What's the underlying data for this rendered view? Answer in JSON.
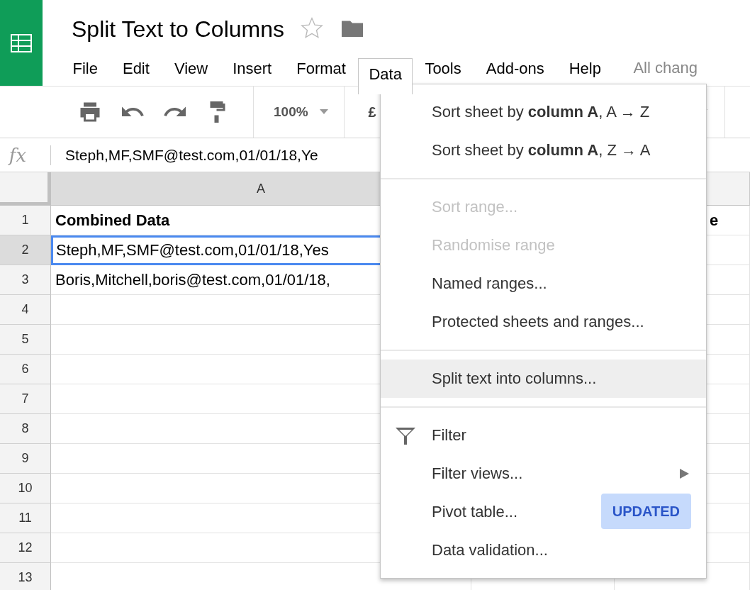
{
  "document": {
    "title": "Split Text to Columns",
    "starred": false
  },
  "menubar": {
    "items": [
      {
        "label": "File",
        "selected": false
      },
      {
        "label": "Edit",
        "selected": false
      },
      {
        "label": "View",
        "selected": false
      },
      {
        "label": "Insert",
        "selected": false
      },
      {
        "label": "Format",
        "selected": false
      },
      {
        "label": "Data",
        "selected": true
      },
      {
        "label": "Tools",
        "selected": false
      },
      {
        "label": "Add-ons",
        "selected": false
      },
      {
        "label": "Help",
        "selected": false
      }
    ],
    "save_status": "All chang"
  },
  "toolbar": {
    "zoom": "100%",
    "currency": "£"
  },
  "formula_bar": {
    "label": "fx",
    "value": "Steph,MF,SMF@test.com,01/01/18,Ye"
  },
  "sheet": {
    "columns": [
      {
        "label": "A",
        "selected": true
      },
      {},
      {
        "selected": false
      }
    ],
    "rows": [
      {
        "number": "1",
        "selected": false,
        "kind": "header",
        "cells": [
          "Combined Data",
          null,
          "e"
        ]
      },
      {
        "number": "2",
        "selected": true,
        "kind": "data",
        "cells": [
          "Steph,MF,SMF@test.com,01/01/18,Yes"
        ]
      },
      {
        "number": "3",
        "selected": false,
        "kind": "data",
        "cells": [
          "Boris,Mitchell,boris@test.com,01/01/18,"
        ]
      },
      {
        "number": "4",
        "selected": false,
        "kind": "data"
      },
      {
        "number": "5",
        "selected": false,
        "kind": "data"
      },
      {
        "number": "6",
        "selected": false,
        "kind": "data"
      },
      {
        "number": "7",
        "selected": false,
        "kind": "data"
      },
      {
        "number": "8",
        "selected": false,
        "kind": "data"
      },
      {
        "number": "9",
        "selected": false,
        "kind": "data"
      },
      {
        "number": "10",
        "selected": false,
        "kind": "data"
      },
      {
        "number": "11",
        "selected": false,
        "kind": "data"
      },
      {
        "number": "12",
        "selected": false,
        "kind": "data"
      },
      {
        "number": "13",
        "selected": false,
        "kind": "data"
      }
    ]
  },
  "data_menu": {
    "groups": [
      [
        {
          "kind": "plain",
          "label": "Sort sheet by **column A**, A → Z",
          "disabled": false,
          "selected": false
        },
        {
          "kind": "plain",
          "label": "Sort sheet by **column A**, Z → A",
          "disabled": false,
          "selected": false
        }
      ],
      [
        {
          "kind": "plain",
          "label": "Sort range...",
          "disabled": true,
          "selected": false
        },
        {
          "kind": "plain",
          "label": "Randomise range",
          "disabled": true,
          "selected": false
        },
        {
          "kind": "plain",
          "label": "Named ranges...",
          "disabled": false,
          "selected": false
        },
        {
          "kind": "plain",
          "label": "Protected sheets and ranges...",
          "disabled": false,
          "selected": false
        }
      ],
      [
        {
          "kind": "plain",
          "label": "Split text into columns...",
          "disabled": false,
          "selected": true
        }
      ],
      [
        {
          "kind": "icon",
          "label": "Filter",
          "disabled": false,
          "selected": false
        },
        {
          "kind": "submenu",
          "label": "Filter views...",
          "disabled": false,
          "selected": false
        },
        {
          "kind": "plain",
          "label": "Pivot table...",
          "disabled": false,
          "selected": false,
          "badge": "UPDATED"
        },
        {
          "kind": "plain",
          "label": "Data validation...",
          "disabled": false,
          "selected": false
        }
      ]
    ]
  }
}
